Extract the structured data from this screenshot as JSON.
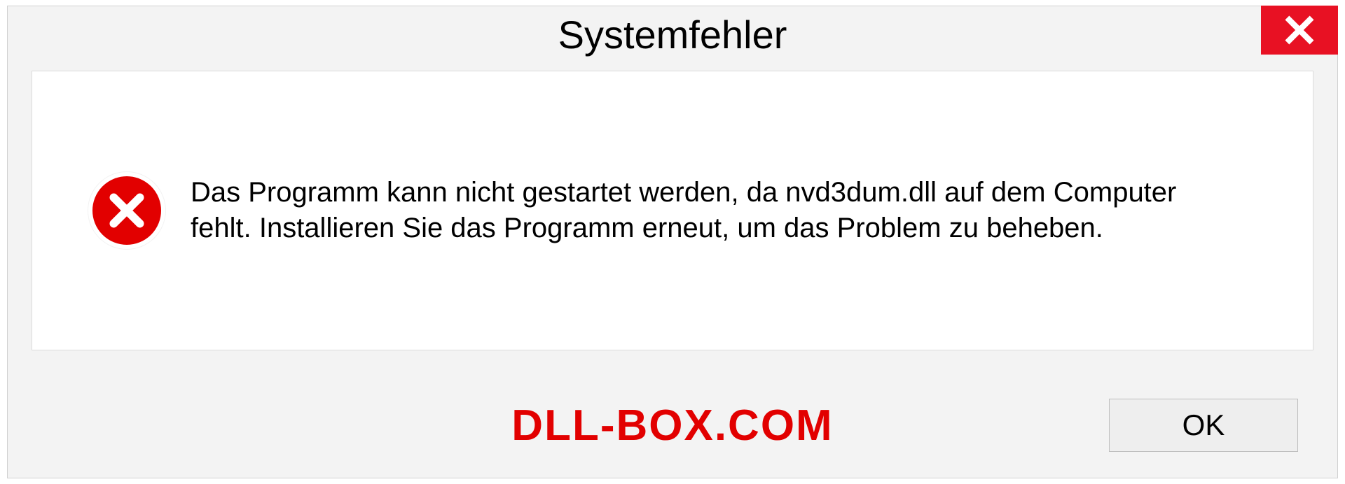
{
  "dialog": {
    "title": "Systemfehler",
    "message": "Das Programm kann nicht gestartet werden, da nvd3dum.dll auf dem Computer fehlt. Installieren Sie das Programm erneut, um das Problem zu beheben.",
    "ok_label": "OK"
  },
  "watermark": "DLL-BOX.COM"
}
